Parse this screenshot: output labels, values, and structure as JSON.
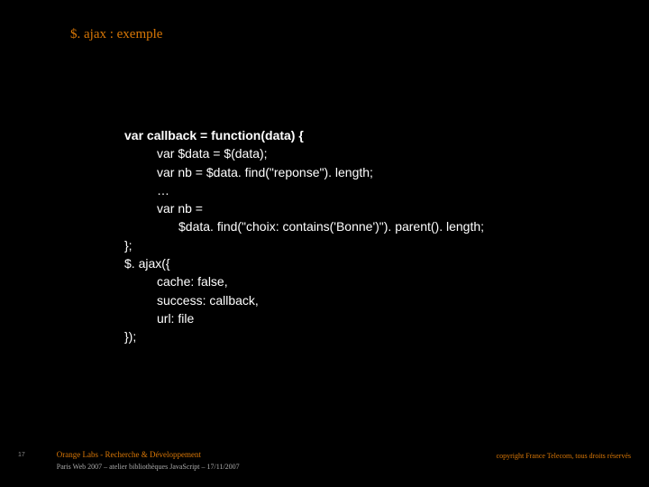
{
  "title": "$. ajax : exemple",
  "code": {
    "l1a": "var callback = ",
    "l1b": "function",
    "l1c": "(data) {",
    "l2": "var $data = $(data);",
    "l3": "var nb = $data. find(\"reponse\"). length;",
    "l4": "…",
    "l5": "var nb =",
    "l6": "$data. find(\"choix: contains('Bonne')\"). parent(). length;",
    "l7": "};",
    "l8": "",
    "l9": "$. ajax({",
    "l10": "cache: false,",
    "l11": "success: callback,",
    "l12": "url: file",
    "l13": "});"
  },
  "footer": {
    "page": "17",
    "left1": "Orange Labs - Recherche & Développement",
    "left2": "Paris Web 2007 – atelier bibliothèques JavaScript – 17/11/2007",
    "right": "copyright France Telecom, tous droits réservés"
  }
}
